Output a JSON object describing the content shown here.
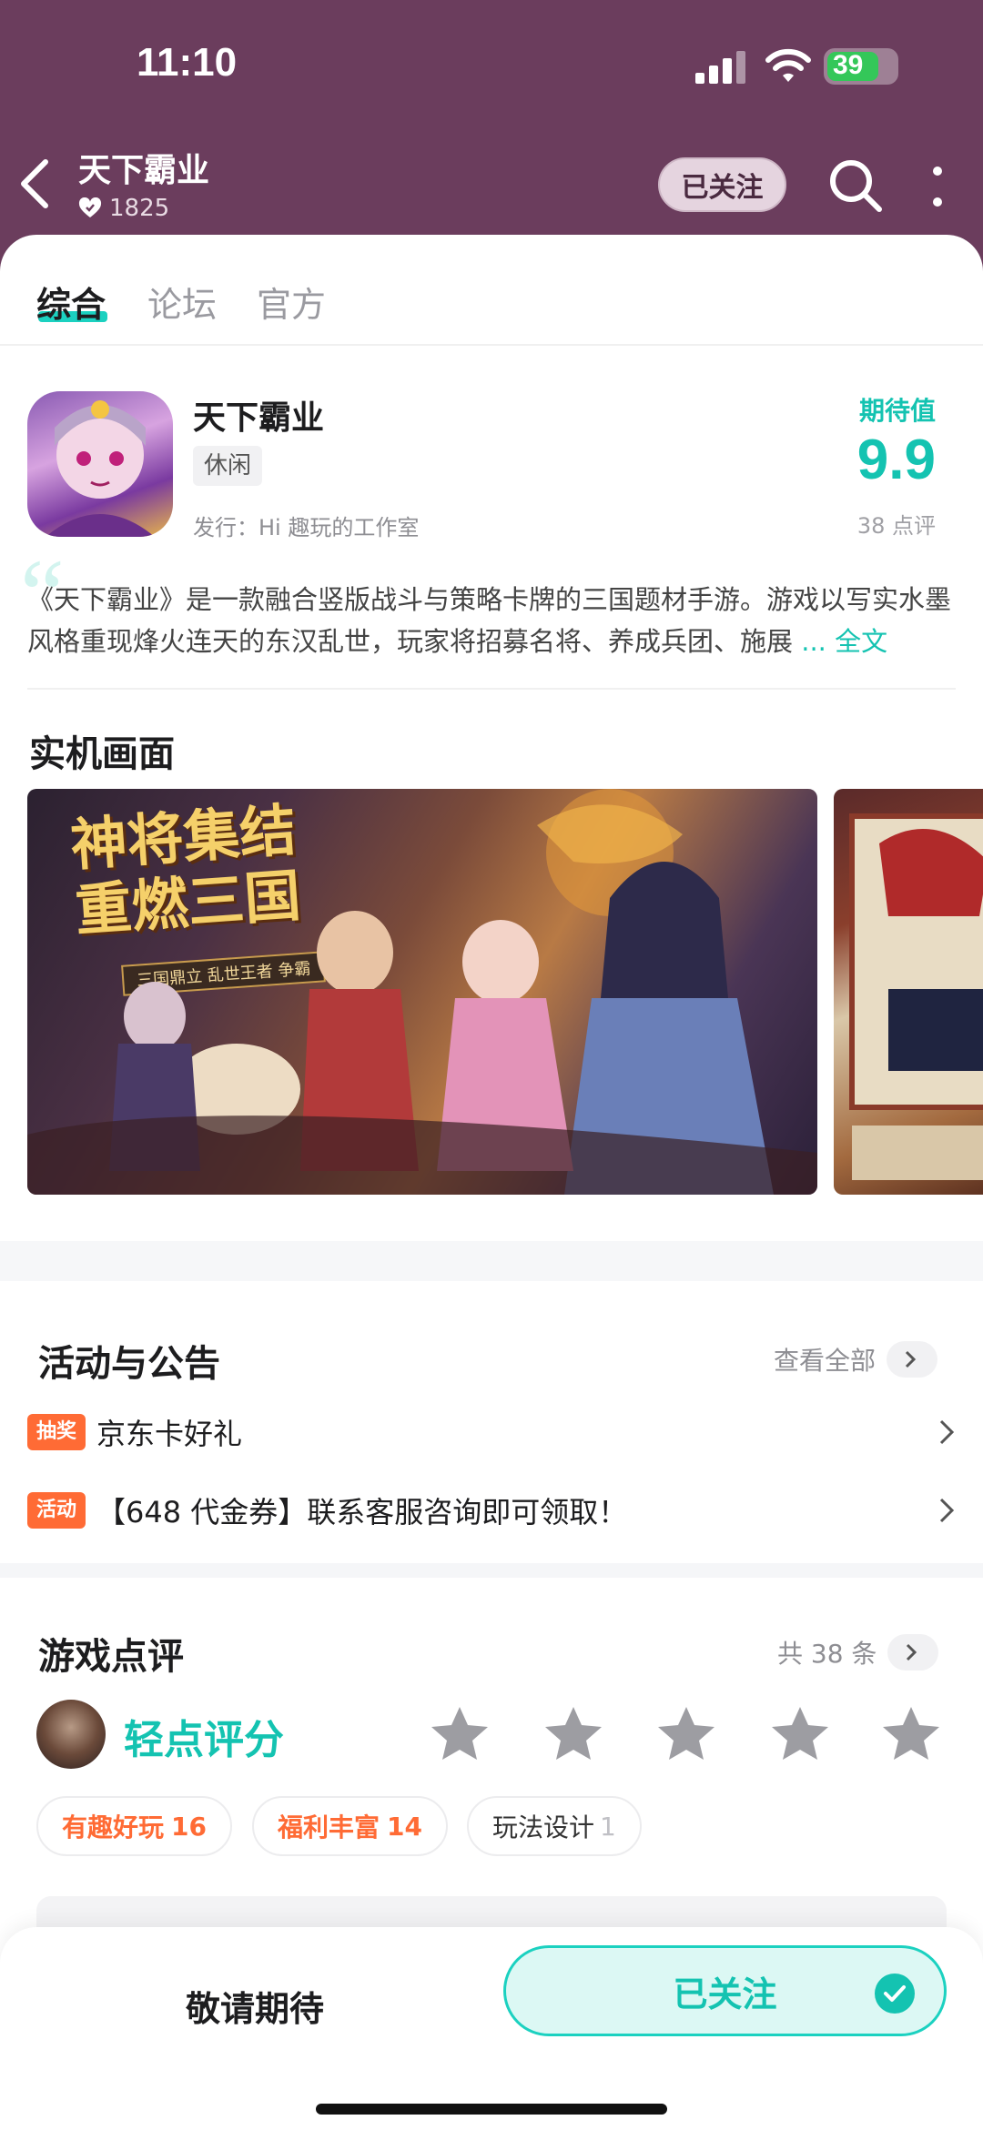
{
  "status_bar": {
    "time": "11:10",
    "battery": "39"
  },
  "nav": {
    "title": "天下霸业",
    "followers": "1825",
    "follow_label": "已关注"
  },
  "tabs": [
    "综合",
    "论坛",
    "官方"
  ],
  "game": {
    "name": "天下霸业",
    "tag": "休闲",
    "publisher": "发行：Hi 趣玩的工作室",
    "expect_label": "期待值",
    "expect_score": "9.9",
    "rating_count": "38 点评",
    "quote": "“",
    "description": "《天下霸业》是一款融合竖版战斗与策略卡牌的三国题材手游。游戏以写实水墨风格重现烽火连天的东汉乱世，玩家将招募名将、养成兵团、施展",
    "more_label": "... 全文"
  },
  "screenshots": {
    "title": "实机画面",
    "banner_title": "神将集结\n重燃三国",
    "banner_sub": "三国鼎立 乱世王者 争霸"
  },
  "events": {
    "title": "活动与公告",
    "view_all": "查看全部",
    "items": [
      {
        "badge": "抽奖",
        "text": "京东卡好礼"
      },
      {
        "badge": "活动",
        "text": "【648 代金券】联系客服咨询即可领取！"
      }
    ]
  },
  "reviews": {
    "title": "游戏点评",
    "total": "共 38 条",
    "rate_prompt": "轻点评分",
    "stars": 5,
    "tags": [
      {
        "label": "有趣好玩",
        "count": "16",
        "hot": true
      },
      {
        "label": "福利丰富",
        "count": "14",
        "hot": true
      },
      {
        "label": "玩法设计",
        "count": "1",
        "hot": false
      }
    ]
  },
  "bottom": {
    "stay_tuned": "敬请期待",
    "followed": "已关注"
  },
  "colors": {
    "header": "#6b3d5d",
    "accent": "#14c3b1",
    "badge": "#ff6b35"
  }
}
